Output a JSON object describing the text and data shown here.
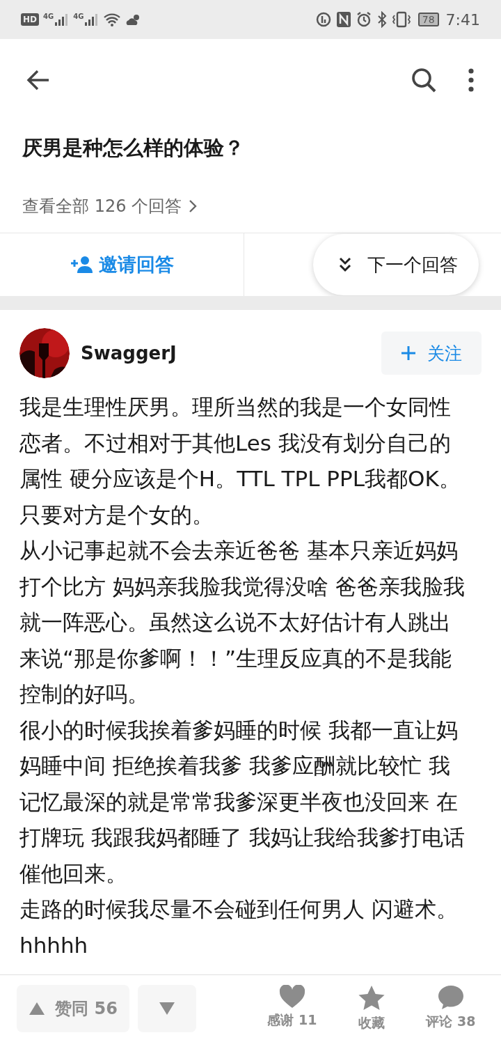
{
  "status_bar": {
    "badge": "HD",
    "networks": [
      "4G",
      "4G"
    ],
    "battery": "78",
    "time": "7:41"
  },
  "question": {
    "title": "厌男是种怎么样的体验？",
    "answers_link": "查看全部 126 个回答"
  },
  "actions": {
    "invite": "邀请回答",
    "next": "下一个回答"
  },
  "author": {
    "name": "SwaggerJ",
    "follow": "关注",
    "following": false
  },
  "paragraphs": [
    "我是生理性厌男。理所当然的我是一个女同性恋者。不过相对于其他Les 我没有划分自己的属性 硬分应该是个H。TTL TPL PPL我都OK。只要对方是个女的。",
    "从小记事起就不会去亲近爸爸 基本只亲近妈妈打个比方 妈妈亲我脸我觉得没啥 爸爸亲我脸我就一阵恶心。虽然这么说不太好估计有人跳出来说“那是你爹啊！！”生理反应真的不是我能控制的好吗。",
    "很小的时候我挨着爹妈睡的时候 我都一直让妈妈睡中间 拒绝挨着我爹 我爹应酬就比较忙 我记忆最深的就是常常我爹深更半夜也没回来 在打牌玩 我跟我妈都睡了 我妈让我给我爹打电话催他回来。",
    "走路的时候我尽量不会碰到任何男人 闪避术。",
    "hhhhh"
  ],
  "footer": {
    "upvote": "赞同 56",
    "items": [
      {
        "kind": "thanks",
        "label": "感谢 11"
      },
      {
        "kind": "favorite",
        "label": "收藏"
      },
      {
        "kind": "comment",
        "label": "评论 38"
      }
    ]
  }
}
